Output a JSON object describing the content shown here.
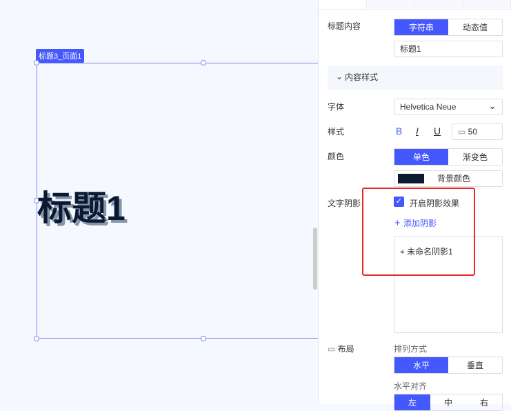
{
  "canvas": {
    "component_tag": "标题3_页面1",
    "title_text": "标题1"
  },
  "panel": {
    "title_content": {
      "label": "标题内容",
      "options": [
        "字符串",
        "动态值"
      ],
      "value": "标题1"
    },
    "section": "内容样式",
    "font": {
      "label": "字体",
      "value": "Helvetica Neue"
    },
    "style": {
      "label": "样式",
      "bold": "B",
      "italic": "I",
      "underline": "U",
      "size": "50"
    },
    "color": {
      "label": "颜色",
      "options": [
        "单色",
        "渐变色"
      ],
      "bg_label": "背景颜色",
      "swatch": "#0a1a33"
    },
    "shadow": {
      "label": "文字阴影",
      "enable_label": "开启阴影效果",
      "add_label": "添加阴影",
      "items": [
        "未命名阴影1"
      ]
    },
    "layout": {
      "label": "布局",
      "arrange_label": "排列方式",
      "arrange_options": [
        "水平",
        "垂直"
      ],
      "align_label": "水平对齐",
      "align_options": [
        "左",
        "中",
        "右"
      ]
    }
  },
  "accent": "#4458fe"
}
